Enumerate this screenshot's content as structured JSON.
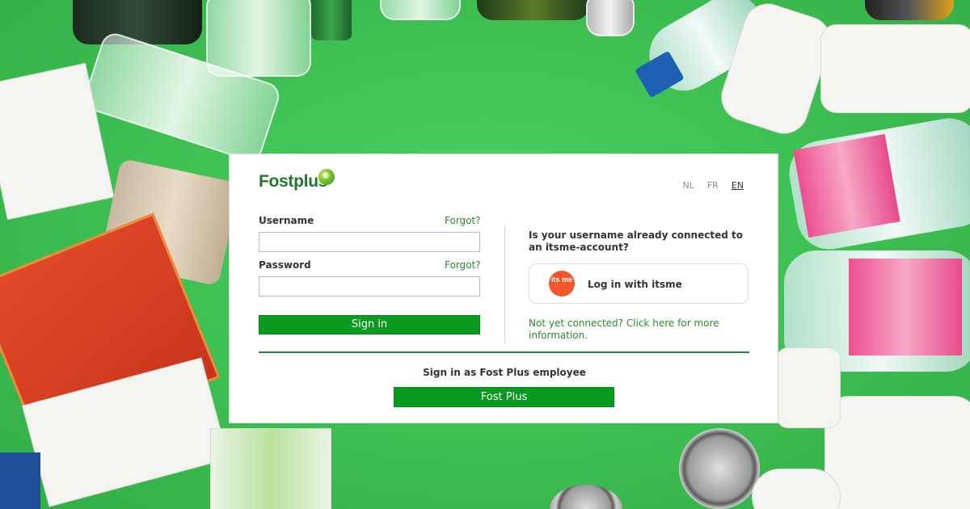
{
  "brand": {
    "logo_text": "Fostplus"
  },
  "languages": {
    "nl": "NL",
    "fr": "FR",
    "en": "EN",
    "active": "EN"
  },
  "form": {
    "username_label": "Username",
    "username_forgot": "Forgot?",
    "username_value": "",
    "password_label": "Password",
    "password_forgot": "Forgot?",
    "password_value": "",
    "signin_label": "Sign in"
  },
  "itsme": {
    "question": "Is your username already connected to an itsme-account?",
    "logo_text": "its me",
    "button_label": "Log in with itsme",
    "info_link": "Not yet connected? Click here for more information."
  },
  "employee": {
    "title": "Sign in as Fost Plus employee",
    "button_label": "Fost Plus"
  },
  "colors": {
    "accent": "#0a9a1f",
    "link": "#2b8a2b",
    "background": "#3fc254",
    "itsme": "#f0572a"
  }
}
